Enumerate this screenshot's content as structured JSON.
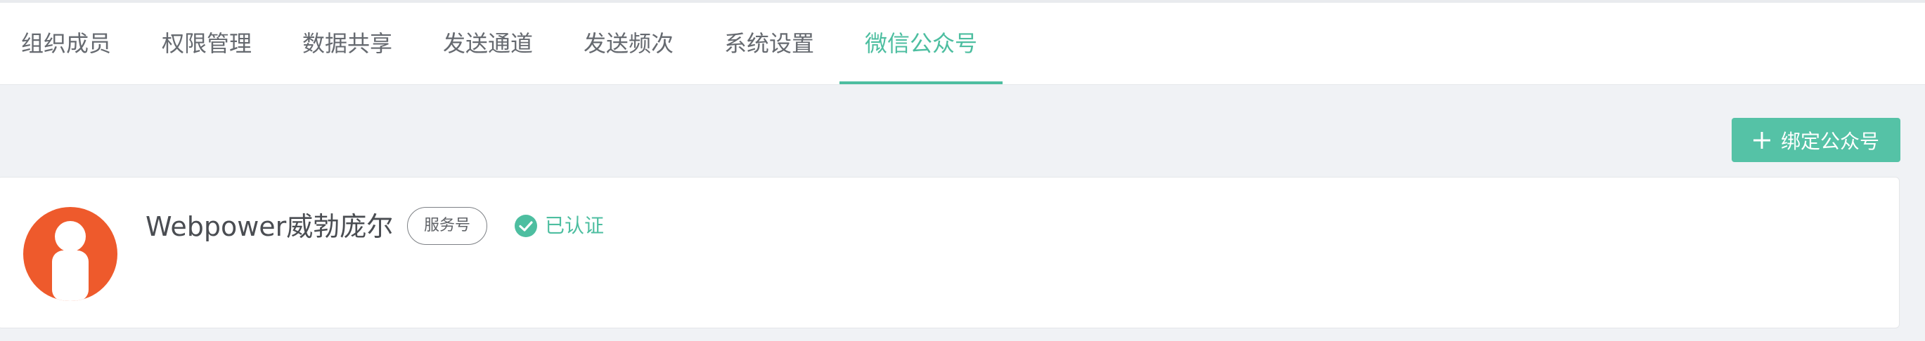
{
  "tabs": [
    {
      "label": "组织成员"
    },
    {
      "label": "权限管理"
    },
    {
      "label": "数据共享"
    },
    {
      "label": "发送通道"
    },
    {
      "label": "发送频次"
    },
    {
      "label": "系统设置"
    },
    {
      "label": "微信公众号",
      "active": true
    }
  ],
  "toolbar": {
    "bind_label": "绑定公众号"
  },
  "account": {
    "name": "Webpower威勃庞尔",
    "type_badge": "服务号",
    "verified_label": "已认证"
  },
  "colors": {
    "accent": "#4dbea0",
    "button": "#55c2a6",
    "avatar": "#ee5a2c",
    "background": "#f0f2f5"
  },
  "icons": {
    "bind": "plus-icon",
    "verified": "check-circle-icon",
    "avatar": "person-icon"
  }
}
